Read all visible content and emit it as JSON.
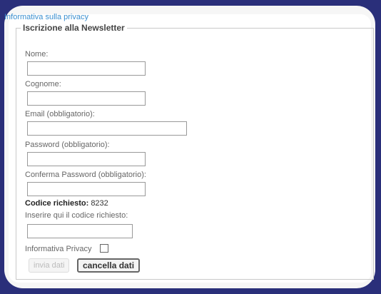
{
  "privacy_link": "Informativa sulla privacy",
  "form": {
    "legend": "Iscrizione alla Newsletter",
    "name_label": "Nome:",
    "surname_label": "Cognome:",
    "email_label": "Email (obbligatorio):",
    "password_label": "Password (obbligatorio):",
    "confirm_password_label": "Conferma Password (obbligatorio):",
    "code_label": "Codice richiesto:",
    "code_value": "8232",
    "code_input_label": "Inserire qui il codice richiesto:",
    "privacy_checkbox_label": "Informativa Privacy",
    "submit_label": "invia dati",
    "clear_label": "cancella dati"
  }
}
